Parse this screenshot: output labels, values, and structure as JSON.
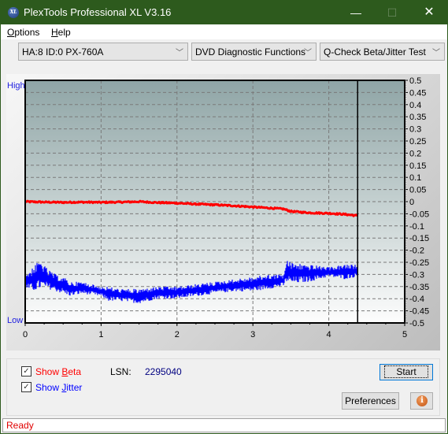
{
  "window": {
    "title": "PlexTools Professional XL V3.16",
    "icon": "xl-logo-icon",
    "icon_text": "XL",
    "controls": {
      "minimize": "—",
      "maximize": "☐",
      "close": "✕"
    }
  },
  "menu": {
    "items": [
      {
        "label": "Options",
        "accel": "O"
      },
      {
        "label": "Help",
        "accel": "H"
      }
    ]
  },
  "toolbar": {
    "drive_select": "HA:8 ID:0  PX-760A",
    "function_select": "DVD Diagnostic Functions",
    "test_select": "Q-Check Beta/Jitter Test",
    "chevron": "﹀"
  },
  "chart_labels": {
    "high": "High",
    "low": "Low"
  },
  "chart_data": {
    "type": "line",
    "title": "",
    "xlabel": "",
    "ylabel": "",
    "xlim": [
      0,
      5
    ],
    "ylim": [
      -0.5,
      0.5
    ],
    "x_ticks": [
      "0",
      "1",
      "2",
      "3",
      "4",
      "5"
    ],
    "y_ticks": [
      "0.5",
      "0.45",
      "0.4",
      "0.35",
      "0.3",
      "0.25",
      "0.2",
      "0.15",
      "0.1",
      "0.05",
      "0",
      "-0.05",
      "-0.1",
      "-0.15",
      "-0.2",
      "-0.25",
      "-0.3",
      "-0.35",
      "-0.4",
      "-0.45",
      "-0.5"
    ],
    "grid": true,
    "marker_x": 4.38,
    "series": [
      {
        "name": "Beta",
        "color": "#ff0000",
        "x": [
          0,
          0.25,
          0.5,
          0.75,
          1.0,
          1.25,
          1.5,
          1.75,
          2.0,
          2.25,
          2.5,
          2.75,
          3.0,
          3.25,
          3.4,
          3.5,
          3.75,
          4.0,
          4.2,
          4.38
        ],
        "y": [
          0.0,
          -0.002,
          -0.003,
          -0.002,
          -0.003,
          -0.002,
          0.0,
          -0.004,
          -0.006,
          -0.01,
          -0.013,
          -0.017,
          -0.022,
          -0.027,
          -0.03,
          -0.04,
          -0.046,
          -0.048,
          -0.052,
          -0.058
        ]
      },
      {
        "name": "Jitter",
        "color": "#0000ff",
        "band": true,
        "x": [
          0,
          0.1,
          0.2,
          0.3,
          0.4,
          0.5,
          0.6,
          0.75,
          1.0,
          1.1,
          1.25,
          1.5,
          1.75,
          2.0,
          2.25,
          2.5,
          2.75,
          3.0,
          3.2,
          3.4,
          3.45,
          3.5,
          3.75,
          4.0,
          4.2,
          4.38
        ],
        "y_high": [
          -0.3,
          -0.27,
          -0.24,
          -0.28,
          -0.3,
          -0.31,
          -0.33,
          -0.33,
          -0.35,
          -0.35,
          -0.36,
          -0.36,
          -0.35,
          -0.35,
          -0.34,
          -0.33,
          -0.32,
          -0.31,
          -0.3,
          -0.3,
          -0.24,
          -0.25,
          -0.26,
          -0.27,
          -0.26,
          -0.26
        ],
        "y_low": [
          -0.36,
          -0.37,
          -0.36,
          -0.36,
          -0.37,
          -0.38,
          -0.39,
          -0.38,
          -0.39,
          -0.41,
          -0.41,
          -0.42,
          -0.4,
          -0.4,
          -0.39,
          -0.38,
          -0.37,
          -0.37,
          -0.36,
          -0.35,
          -0.33,
          -0.34,
          -0.33,
          -0.31,
          -0.32,
          -0.31
        ]
      }
    ]
  },
  "controls": {
    "show_beta": {
      "label": "Show Beta",
      "accel": "B",
      "checked": true,
      "color": "#ff0000"
    },
    "show_jitter": {
      "label": "Show Jitter",
      "accel": "J",
      "checked": true,
      "color": "#0000ff"
    },
    "lsn_label": "LSN:",
    "lsn_value": "2295040",
    "start_label": "Start",
    "preferences_label": "Preferences",
    "info_icon": "i"
  },
  "status": {
    "text": "Ready"
  }
}
